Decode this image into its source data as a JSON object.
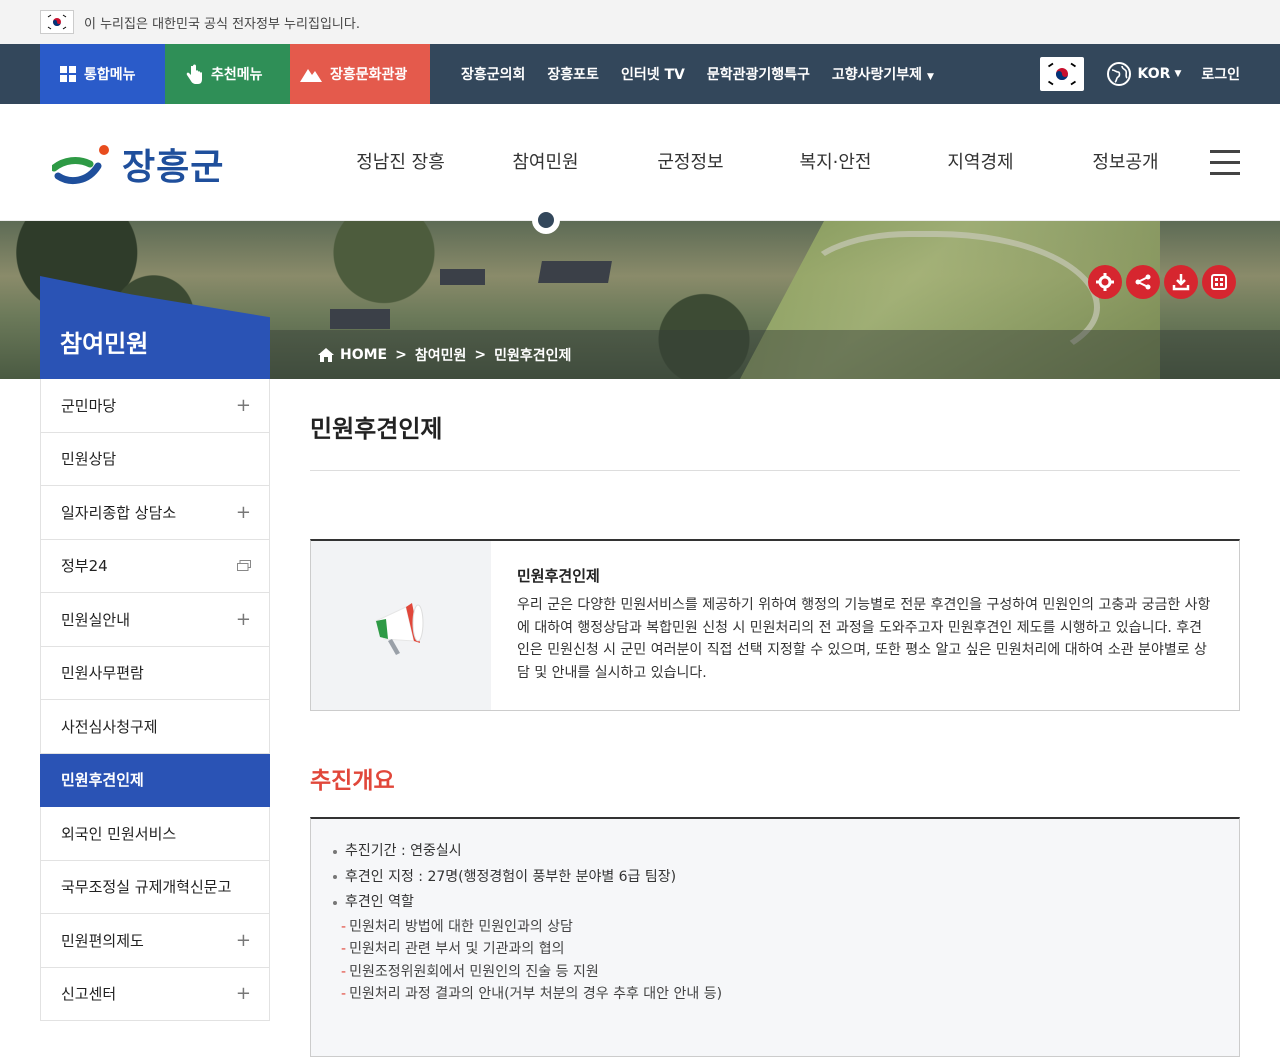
{
  "gov_banner": {
    "text": "이 누리집은 대한민국 공식 전자정부 누리집입니다."
  },
  "util": {
    "integrated_menu": "통합메뉴",
    "recommend_menu": "추천메뉴",
    "culture_tour": "장흥문화관광",
    "links": [
      "장흥군의회",
      "장흥포토",
      "인터넷 TV",
      "문학관광기행특구",
      "고향사랑기부제"
    ],
    "language": "KOR",
    "login": "로그인"
  },
  "header": {
    "logo_text": "장흥군",
    "gnb": [
      "정남진 장흥",
      "참여민원",
      "군정정보",
      "복지·안전",
      "지역경제",
      "정보공개"
    ]
  },
  "breadcrumb": {
    "home": "HOME",
    "level1": "참여민원",
    "level2": "민원후견인제",
    "sep": ">"
  },
  "sidebar": {
    "title": "참여민원",
    "items": [
      {
        "label": "군민마당",
        "type": "plus"
      },
      {
        "label": "민원상담",
        "type": "none"
      },
      {
        "label": "일자리종합 상담소",
        "type": "plus"
      },
      {
        "label": "정부24",
        "type": "window"
      },
      {
        "label": "민원실안내",
        "type": "plus"
      },
      {
        "label": "민원사무편람",
        "type": "none"
      },
      {
        "label": "사전심사청구제",
        "type": "none"
      },
      {
        "label": "민원후견인제",
        "type": "active"
      },
      {
        "label": "외국인 민원서비스",
        "type": "none"
      },
      {
        "label": "국무조정실 규제개혁신문고",
        "type": "none"
      },
      {
        "label": "민원편의제도",
        "type": "plus"
      },
      {
        "label": "신고센터",
        "type": "plus"
      }
    ],
    "plus_symbol": "+"
  },
  "content": {
    "page_title": "민원후견인제",
    "intro_heading": "민원후견인제",
    "intro_body": "우리 군은 다양한 민원서비스를 제공하기 위하여 행정의 기능별로 전문 후견인을 구성하여 민원인의 고충과 궁금한 사항에 대하여 행정상담과 복합민원 신청 시 민원처리의 전 과정을 도와주고자 민원후견인 제도를 시행하고 있습니다. 후견인은 민원신청 시 군민 여러분이 직접 선택 지정할 수 있으며, 또한 평소 알고 싶은 민원처리에 대하여 소관 분야별로 상담 및 안내를 실시하고 있습니다.",
    "section_title": "추진개요",
    "overview": {
      "period": "추진기간 : 연중실시",
      "designation": "후견인 지정 : 27명(행정경험이 풍부한 분야별 6급 팀장)",
      "role_title": "후견인 역할",
      "roles": [
        "민원처리 방법에 대한 민원인과의 상담",
        "민원처리 관련 부서 및 기관과의 협의",
        "민원조정위원회에서 민원인의 진술 등 지원",
        "민원처리 과정 결과의 안내(거부 처분의 경우 추후 대안 안내 등)"
      ],
      "dash": "-"
    }
  }
}
